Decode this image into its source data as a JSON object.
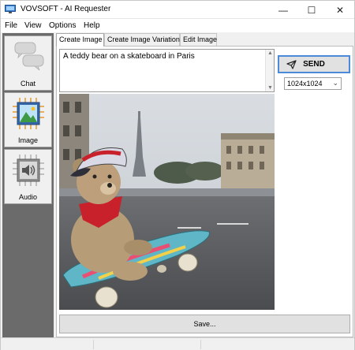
{
  "window": {
    "title": "VOVSOFT - AI Requester",
    "minimize_glyph": "—",
    "maximize_glyph": "☐",
    "close_glyph": "✕"
  },
  "menu": [
    "File",
    "View",
    "Options",
    "Help"
  ],
  "sidebar": {
    "items": [
      {
        "label": "Chat",
        "icon": "chat-bubbles-icon",
        "active": false
      },
      {
        "label": "Image",
        "icon": "image-chip-icon",
        "active": true
      },
      {
        "label": "Audio",
        "icon": "speaker-chip-icon",
        "active": false
      }
    ]
  },
  "tabs": [
    {
      "label": "Create Image",
      "active": true
    },
    {
      "label": "Create Image Variation",
      "active": false
    },
    {
      "label": "Edit Image",
      "active": false
    }
  ],
  "prompt": {
    "value": "A teddy bear on a skateboard in Paris"
  },
  "send_button": {
    "label": "SEND",
    "icon": "send-arrow-icon"
  },
  "size_select": {
    "value": "1024x1024"
  },
  "save_button": {
    "label": "Save..."
  },
  "colors": {
    "accent_border": "#4a8ad8",
    "sidebar_bg": "#6b6b6b",
    "window_bg": "#f0f0f0"
  }
}
